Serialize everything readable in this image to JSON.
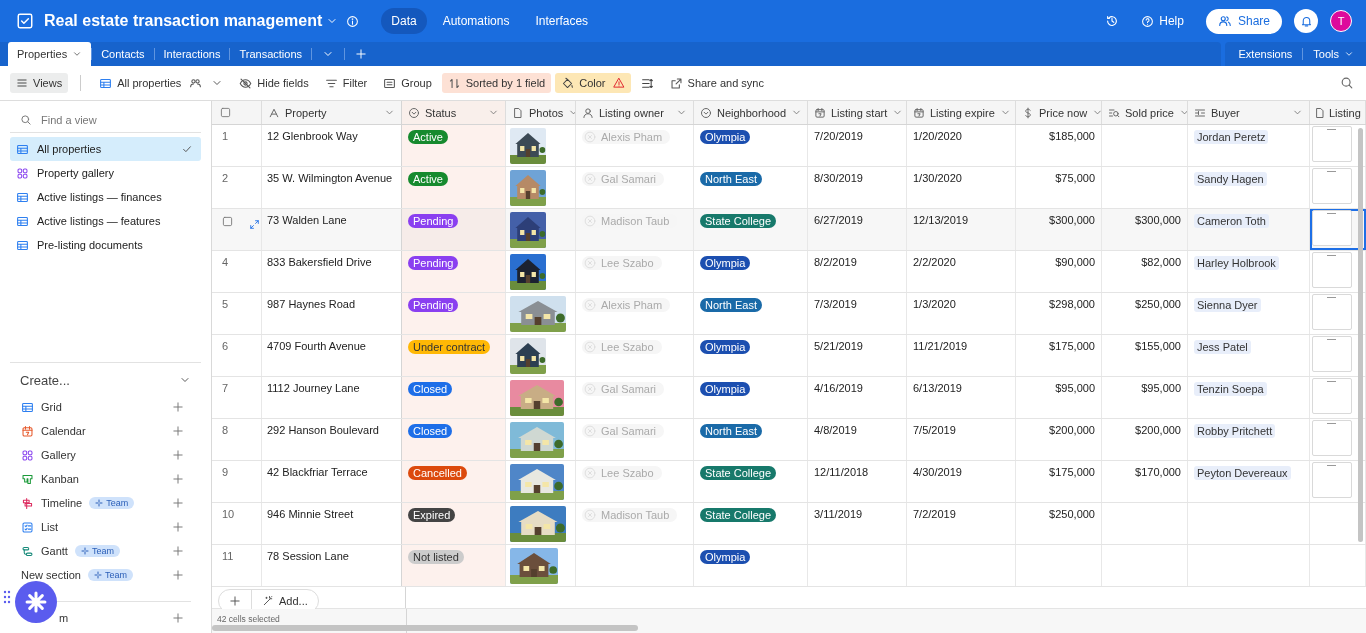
{
  "app": {
    "title": "Real estate transaction management",
    "nav": [
      {
        "label": "Data",
        "selected": true
      },
      {
        "label": "Automations",
        "selected": false
      },
      {
        "label": "Interfaces",
        "selected": false
      }
    ],
    "help": "Help",
    "share": "Share",
    "avatar": "T"
  },
  "table_tabs": {
    "tabs": [
      {
        "label": "Properties",
        "selected": true
      },
      {
        "label": "Contacts",
        "selected": false
      },
      {
        "label": "Interactions",
        "selected": false
      },
      {
        "label": "Transactions",
        "selected": false
      }
    ],
    "extensions": "Extensions",
    "tools": "Tools"
  },
  "toolbar": {
    "views": "Views",
    "view_name": "All properties",
    "hide_fields": "Hide fields",
    "filter": "Filter",
    "group": "Group",
    "sort": "Sorted by 1 field",
    "color_by": "Color",
    "share_sync": "Share and sync"
  },
  "sidebar": {
    "search": {
      "placeholder": "Find a view"
    },
    "views": [
      {
        "label": "All properties",
        "kind": "grid",
        "selected": true
      },
      {
        "label": "Property gallery",
        "kind": "gallery",
        "selected": false
      },
      {
        "label": "Active listings — finances",
        "kind": "grid",
        "selected": false
      },
      {
        "label": "Active listings — features",
        "kind": "grid",
        "selected": false
      },
      {
        "label": "Pre-listing documents",
        "kind": "grid",
        "selected": false
      }
    ],
    "create": {
      "title": "Create...",
      "items": [
        {
          "label": "Grid",
          "kind": "grid"
        },
        {
          "label": "Calendar",
          "kind": "calendar"
        },
        {
          "label": "Gallery",
          "kind": "gallery"
        },
        {
          "label": "Kanban",
          "kind": "kanban"
        },
        {
          "label": "Timeline",
          "kind": "timeline",
          "badge": "Team"
        },
        {
          "label": "List",
          "kind": "list"
        },
        {
          "label": "Gantt",
          "kind": "gantt",
          "badge": "Team"
        },
        {
          "label": "New section",
          "kind": "section",
          "badge": "Team"
        },
        {
          "label": "m",
          "kind": "form"
        }
      ]
    }
  },
  "grid": {
    "columns": [
      {
        "label": "Property",
        "kind": "text"
      },
      {
        "label": "Status",
        "kind": "select"
      },
      {
        "label": "Photos",
        "kind": "attachment"
      },
      {
        "label": "Listing owner",
        "kind": "user"
      },
      {
        "label": "Neighborhood",
        "kind": "select"
      },
      {
        "label": "Listing start",
        "kind": "date"
      },
      {
        "label": "Listing expire",
        "kind": "date"
      },
      {
        "label": "Price now",
        "kind": "currency"
      },
      {
        "label": "Sold price",
        "kind": "rollup"
      },
      {
        "label": "Buyer",
        "kind": "link"
      },
      {
        "label": "Listing",
        "kind": "attachment"
      }
    ],
    "rows": [
      {
        "number": "1",
        "selected": false,
        "property": "12 Glenbrook Way",
        "status": {
          "label": "Active",
          "color": "#168a2e"
        },
        "owner": "Alexis Pham",
        "neighborhood": {
          "label": "Olympia",
          "color": "#1c4fb0"
        },
        "listing_start": "7/20/2019",
        "listing_expire": "1/20/2020",
        "price_now": "$185,000",
        "buyer": "Jordan Peretz",
        "has_attachment": true
      },
      {
        "number": "2",
        "selected": false,
        "property": "35 W. Wilmington Avenue",
        "status": {
          "label": "Active",
          "color": "#168a2e"
        },
        "owner": "Gal Samari",
        "neighborhood": {
          "label": "North East",
          "color": "#1a6aa8"
        },
        "listing_start": "8/30/2019",
        "listing_expire": "1/30/2020",
        "price_now": "$75,000",
        "buyer": "Sandy Hagen",
        "has_attachment": true
      },
      {
        "selected": true,
        "property": "73 Walden Lane",
        "status": {
          "label": "Pending",
          "color": "#8a3ff0"
        },
        "owner": "Madison Taub",
        "neighborhood": {
          "label": "State College",
          "color": "#17796b"
        },
        "listing_start": "6/27/2019",
        "listing_expire": "12/13/2019",
        "price_now": "$300,000",
        "sold_price": "$300,000",
        "buyer": "Cameron Toth",
        "has_attachment": true
      },
      {
        "number": "4",
        "selected": false,
        "property": "833 Bakersfield Drive",
        "status": {
          "label": "Pending",
          "color": "#8a3ff0"
        },
        "owner": "Lee Szabo",
        "neighborhood": {
          "label": "Olympia",
          "color": "#1c4fb0"
        },
        "listing_start": "8/2/2019",
        "listing_expire": "2/2/2020",
        "price_now": "$90,000",
        "sold_price": "$82,000",
        "buyer": "Harley Holbrook",
        "has_attachment": true
      },
      {
        "number": "5",
        "selected": false,
        "property": "987 Haynes Road",
        "status": {
          "label": "Pending",
          "color": "#8a3ff0"
        },
        "owner": "Alexis Pham",
        "neighborhood": {
          "label": "North East",
          "color": "#1a6aa8"
        },
        "listing_start": "7/3/2019",
        "listing_expire": "1/3/2020",
        "price_now": "$298,000",
        "sold_price": "$250,000",
        "buyer": "Sienna Dyer",
        "has_attachment": true
      },
      {
        "number": "6",
        "selected": false,
        "property": "4709 Fourth Avenue",
        "status": {
          "label": "Under contract",
          "color": "#ffb805"
        },
        "owner": "Lee Szabo",
        "neighborhood": {
          "label": "Olympia",
          "color": "#1c4fb0"
        },
        "listing_start": "5/21/2019",
        "listing_expire": "11/21/2019",
        "price_now": "$175,000",
        "sold_price": "$155,000",
        "buyer": "Jess Patel",
        "has_attachment": true
      },
      {
        "number": "7",
        "selected": false,
        "property": "1112 Journey Lane",
        "status": {
          "label": "Closed",
          "color": "#1d6ee8"
        },
        "owner": "Gal Samari",
        "neighborhood": {
          "label": "Olympia",
          "color": "#1c4fb0"
        },
        "listing_start": "4/16/2019",
        "listing_expire": "6/13/2019",
        "price_now": "$95,000",
        "sold_price": "$95,000",
        "buyer": "Tenzin Soepa",
        "has_attachment": true
      },
      {
        "number": "8",
        "selected": false,
        "property": "292 Hanson Boulevard",
        "status": {
          "label": "Closed",
          "color": "#1d6ee8"
        },
        "owner": "Gal Samari",
        "neighborhood": {
          "label": "North East",
          "color": "#1a6aa8"
        },
        "listing_start": "4/8/2019",
        "listing_expire": "7/5/2019",
        "price_now": "$200,000",
        "sold_price": "$200,000",
        "buyer": "Robby Pritchett",
        "has_attachment": true
      },
      {
        "number": "9",
        "selected": false,
        "property": "42 Blackfriar Terrace",
        "status": {
          "label": "Cancelled",
          "color": "#dc4a0d"
        },
        "owner": "Lee Szabo",
        "neighborhood": {
          "label": "State College",
          "color": "#17796b"
        },
        "listing_start": "12/11/2018",
        "listing_expire": "4/30/2019",
        "price_now": "$175,000",
        "sold_price": "$170,000",
        "buyer": "Peyton Devereaux",
        "has_attachment": true
      },
      {
        "number": "10",
        "selected": false,
        "property": "946 Minnie Street",
        "status": {
          "label": "Expired",
          "color": "#444444"
        },
        "owner": "Madison Taub",
        "neighborhood": {
          "label": "State College",
          "color": "#17796b"
        },
        "listing_start": "3/11/2019",
        "listing_expire": "7/2/2019",
        "price_now": "$250,000",
        "has_attachment": false
      },
      {
        "number": "11",
        "selected": false,
        "property": "78 Session Lane",
        "status": {
          "label": "Not listed",
          "color": "#cccccc"
        },
        "neighborhood": {
          "label": "Olympia",
          "color": "#1c4fb0"
        },
        "has_attachment": false
      }
    ],
    "add_label": "Add...",
    "summary": "42 cells selected"
  }
}
